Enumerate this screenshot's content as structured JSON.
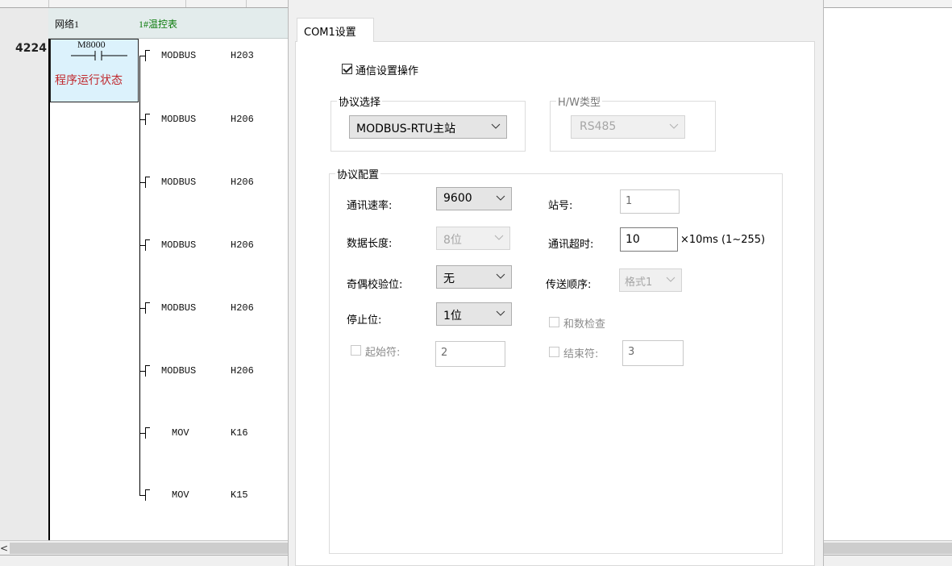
{
  "ladder": {
    "rung_number": "4224",
    "network_name": "网络1",
    "network_comment": "1#温控表",
    "contact": {
      "address": "M8000",
      "comment": "程序运行状态"
    },
    "instructions": [
      {
        "name": "MODBUS",
        "operand": "H203"
      },
      {
        "name": "MODBUS",
        "operand": "H206"
      },
      {
        "name": "MODBUS",
        "operand": "H206"
      },
      {
        "name": "MODBUS",
        "operand": "H206"
      },
      {
        "name": "MODBUS",
        "operand": "H206"
      },
      {
        "name": "MODBUS",
        "operand": "H206"
      },
      {
        "name": "MOV",
        "operand": "K16"
      },
      {
        "name": "MOV",
        "operand": "K15"
      }
    ],
    "scroll_arrow": "<"
  },
  "dialog": {
    "tab_label": "COM1设置",
    "comm_setting": {
      "label": "通信设置操作",
      "checked": true
    },
    "protocol_select": {
      "title": "协议选择",
      "value": "MODBUS-RTU主站"
    },
    "hw_type": {
      "title": "H/W类型",
      "value": "RS485"
    },
    "protocol_config": {
      "title": "协议配置",
      "baud_rate": {
        "label": "通讯速率:",
        "value": "9600"
      },
      "station": {
        "label": "站号:",
        "value": "1"
      },
      "data_length": {
        "label": "数据长度:",
        "value": "8位"
      },
      "timeout": {
        "label": "通讯超时:",
        "value": "10",
        "suffix": "×10ms (1~255)"
      },
      "parity": {
        "label": "奇偶校验位:",
        "value": "无"
      },
      "send_order": {
        "label": "传送顺序:",
        "value": "格式1"
      },
      "stop_bits": {
        "label": "停止位:",
        "value": "1位"
      },
      "checksum": {
        "label": "和数检查",
        "checked": false
      },
      "start_char": {
        "label": "起始符:",
        "value": "2",
        "checked": false
      },
      "end_char": {
        "label": "结束符:",
        "value": "3",
        "checked": false
      }
    }
  }
}
